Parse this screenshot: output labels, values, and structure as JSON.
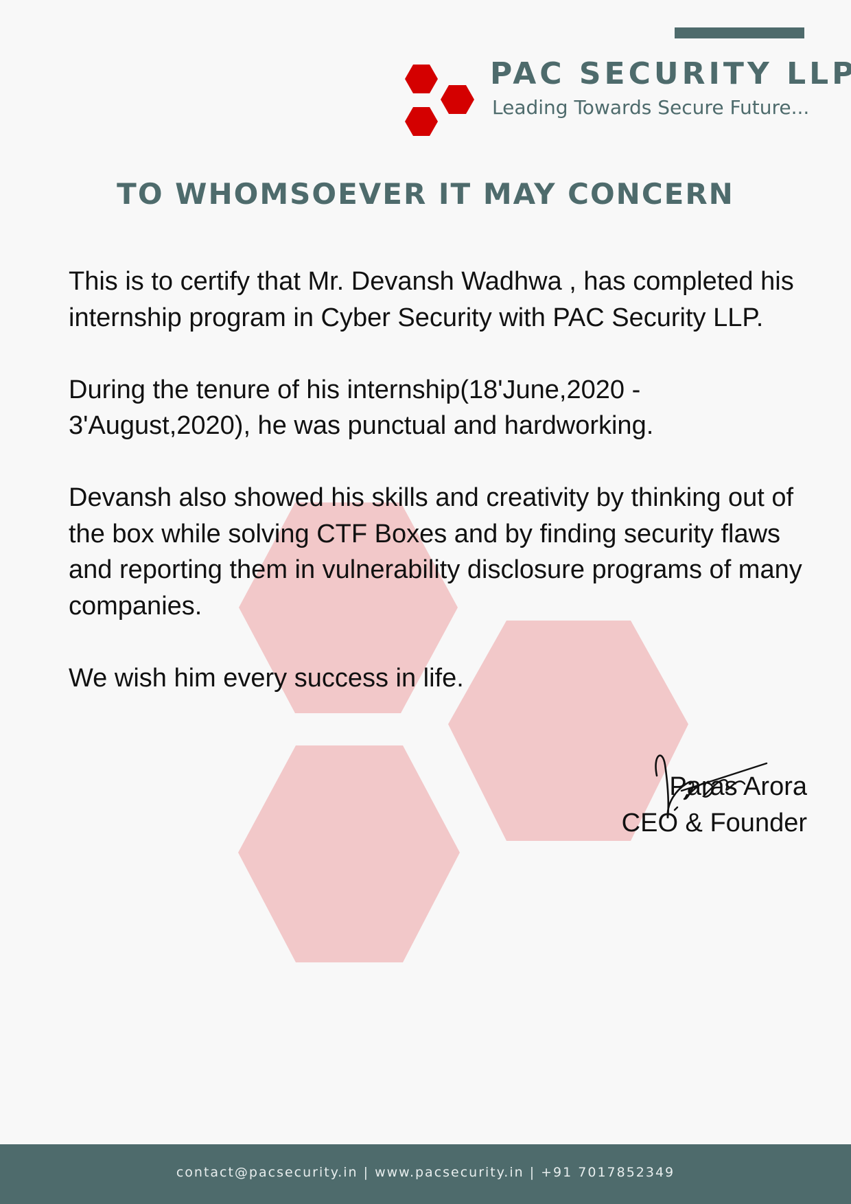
{
  "header": {
    "company_name": "PAC SECURITY LLP",
    "tagline": "Leading Towards Secure Future..."
  },
  "logo": {
    "icon": "red-hexagon-cluster-logo",
    "color": "#d40000"
  },
  "heading": "TO WHOMSOEVER IT MAY CONCERN",
  "body": {
    "paragraphs": [
      "This is to certify that Mr. Devansh Wadhwa ,  has completed his internship program in Cyber Security  with PAC Security LLP.",
      "During the tenure of his internship(18'June,2020  -\n 3'August,2020), he was punctual and hardworking.",
      "Devansh also showed his skills and creativity by thinking out of the box while solving CTF Boxes and by finding security flaws and reporting them in vulnerability disclosure programs of many companies.",
      "We wish him every success in life."
    ]
  },
  "signatory": {
    "name": "Paras Arora",
    "title": "CEO & Founder",
    "signature_icon": "handwritten-signature"
  },
  "footer": {
    "contact": "contact@pacsecurity.in | www.pacsecurity.in | +91 7017852349"
  },
  "colors": {
    "accent": "#4e6b6c",
    "brand_red": "#d40000",
    "watermark": "#f2c8c9",
    "background": "#f8f8f8"
  }
}
